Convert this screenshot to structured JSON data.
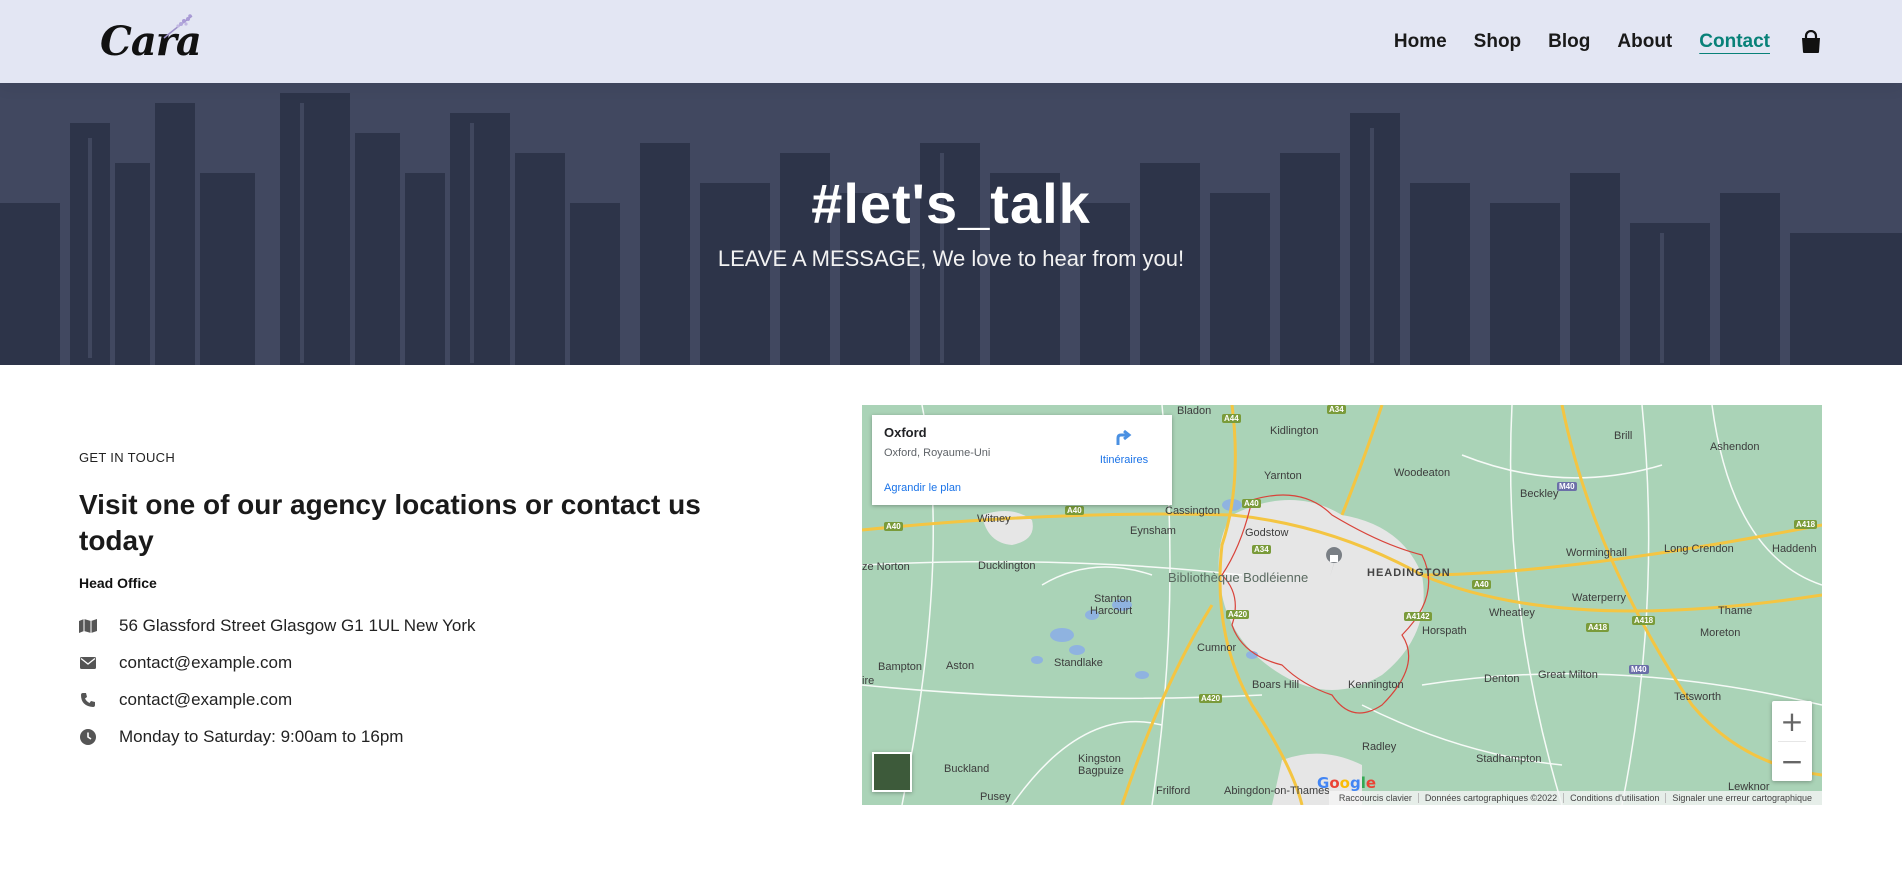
{
  "header": {
    "logo": "Cara",
    "nav": [
      {
        "label": "Home",
        "active": false
      },
      {
        "label": "Shop",
        "active": false
      },
      {
        "label": "Blog",
        "active": false
      },
      {
        "label": "About",
        "active": false
      },
      {
        "label": "Contact",
        "active": true
      }
    ],
    "accent": "#088178",
    "background": "#e3e6f3",
    "cart_icon": "shopping-bag-icon"
  },
  "hero": {
    "title": "#let's_talk",
    "subtitle": "LEAVE A MESSAGE, We love to hear from you!"
  },
  "contact": {
    "eyebrow": "GET IN TOUCH",
    "heading": "Visit one of our agency locations or contact us today",
    "office_label": "Head Office",
    "items": [
      {
        "icon": "map-icon",
        "text": "56 Glassford Street Glasgow G1 1UL New York"
      },
      {
        "icon": "envelope-icon",
        "text": "contact@example.com"
      },
      {
        "icon": "phone-icon",
        "text": "contact@example.com"
      },
      {
        "icon": "clock-icon",
        "text": "Monday to Saturday: 9:00am to 16pm"
      }
    ]
  },
  "map": {
    "place_name": "Oxford",
    "place_address": "Oxford, Royaume-Uni",
    "directions_label": "Itinéraires",
    "enlarge_label": "Agrandir le plan",
    "zoom_in": "+",
    "zoom_out": "−",
    "google": "Google",
    "attribution": [
      "Raccourcis clavier",
      "Données cartographiques ©2022",
      "Conditions d'utilisation",
      "Signaler une erreur cartographique"
    ],
    "labels": {
      "bladon": "Bladon",
      "kidlington": "Kidlington",
      "brill": "Brill",
      "ashendon": "Ashendon",
      "yarnton": "Yarnton",
      "woodeaton": "Woodeaton",
      "beckley": "Beckley",
      "cassington": "Cassington",
      "witney": "Witney",
      "eynsham": "Eynsham",
      "godstow": "Godstow",
      "worminghall": "Worminghall",
      "long_crendon": "Long Crendon",
      "haddenham": "Haddenh",
      "ducklington": "Ducklington",
      "bodleian": "Bibliothèque Bodléienne",
      "headington": "HEADINGTON",
      "norton": "ze Norton",
      "stanton": "Stanton",
      "harcourt": "Harcourt",
      "waterperry": "Waterperry",
      "wheatley": "Wheatley",
      "thame": "Thame",
      "horspath": "Horspath",
      "moreton": "Moreton",
      "bampton": "Bampton",
      "aston": "Aston",
      "standlake": "Standlake",
      "cumnor": "Cumnor",
      "denton": "Denton",
      "great_milton": "Great Milton",
      "boars_hill": "Boars Hill",
      "kennington": "Kennington",
      "tetsworth": "Tetsworth",
      "radley": "Radley",
      "buckland": "Buckland",
      "kingston": "Kingston",
      "bagpuize": "Bagpuize",
      "stadhampton": "Stadhampton",
      "pusey": "Pusey",
      "frilford": "Frilford",
      "abingdon": "Abingdon-on-Thames",
      "lewknor": "Lewknor",
      "ire": "ire"
    },
    "roads": {
      "a44": "A44",
      "a34": "A34",
      "a40a": "A40",
      "a40b": "A40",
      "a40c": "A40",
      "a40d": "A40",
      "a420a": "A420",
      "a420b": "A420",
      "a4142": "A4142",
      "a418a": "A418",
      "a418b": "A418",
      "a418c": "A418",
      "m40a": "M40",
      "m40b": "M40",
      "a34b": "A34"
    }
  }
}
